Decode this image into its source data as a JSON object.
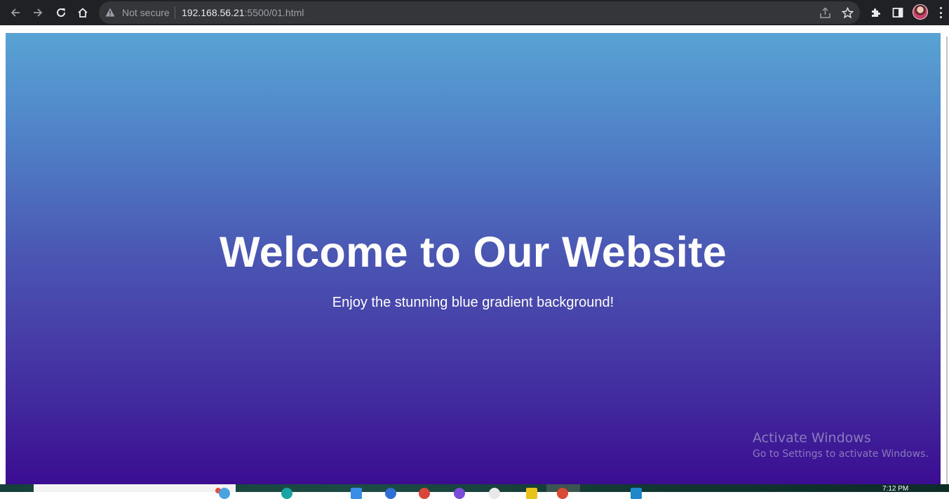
{
  "browser": {
    "security_label": "Not secure",
    "url_host": "192.168.56.21",
    "url_rest": ":5500/01.html",
    "icons": [
      "back-arrow-icon",
      "forward-arrow-icon",
      "reload-icon",
      "home-icon",
      "warning-icon",
      "share-icon",
      "star-icon",
      "extensions-icon",
      "side-panel-icon",
      "avatar",
      "menu-icon"
    ]
  },
  "page": {
    "title": "Welcome to Our Website",
    "subtitle": "Enjoy the stunning blue gradient background!",
    "gradient_top": "#58a3d4",
    "gradient_bottom": "#3b0d91"
  },
  "watermark": {
    "title": "Activate Windows",
    "subtitle": "Go to Settings to activate Windows."
  },
  "taskbar": {
    "clock": "7:12 PM"
  }
}
